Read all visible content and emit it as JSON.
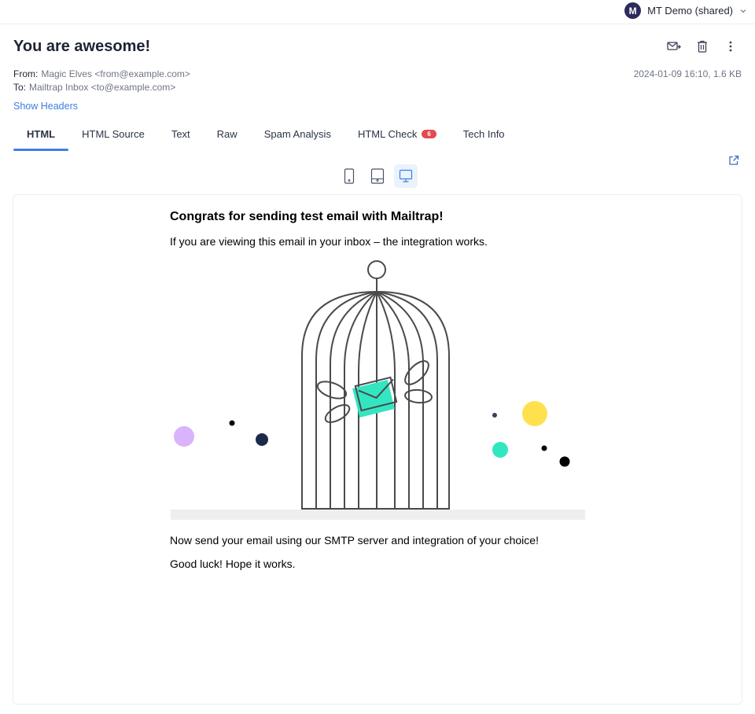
{
  "account": {
    "initial": "M",
    "name": "MT Demo (shared)"
  },
  "message": {
    "subject": "You are awesome!",
    "from_label": "From:",
    "from_value": "Magic Elves <from@example.com>",
    "to_label": "To:",
    "to_value": "Mailtrap Inbox <to@example.com>",
    "date_size": "2024-01-09 16:10, 1.6 KB",
    "show_headers": "Show Headers"
  },
  "actions": [
    "forward-icon",
    "trash-icon",
    "more-icon"
  ],
  "tabs": [
    {
      "label": "HTML",
      "active": true
    },
    {
      "label": "HTML Source"
    },
    {
      "label": "Text"
    },
    {
      "label": "Raw"
    },
    {
      "label": "Spam Analysis"
    },
    {
      "label": "HTML Check",
      "badge": "6"
    },
    {
      "label": "Tech Info"
    }
  ],
  "devices": [
    "mobile-icon",
    "tablet-icon",
    "desktop-icon"
  ],
  "selected_device": "desktop",
  "email_body": {
    "heading": "Congrats for sending test email with Mailtrap!",
    "intro": "If you are viewing this email in your inbox – the integration works.",
    "cta": "Now send your email using our SMTP server and integration of your choice!",
    "closing": "Good luck! Hope it works."
  },
  "colors": {
    "accent": "#3f7fe6",
    "badge": "#e5484d",
    "avatar": "#2d2a5c",
    "envelope": "#33e6c2",
    "dot_purple": "#d9b3fb",
    "dot_yellow": "#ffe14d",
    "dot_teal": "#33e6c2",
    "dot_navy": "#1c2a4a"
  }
}
